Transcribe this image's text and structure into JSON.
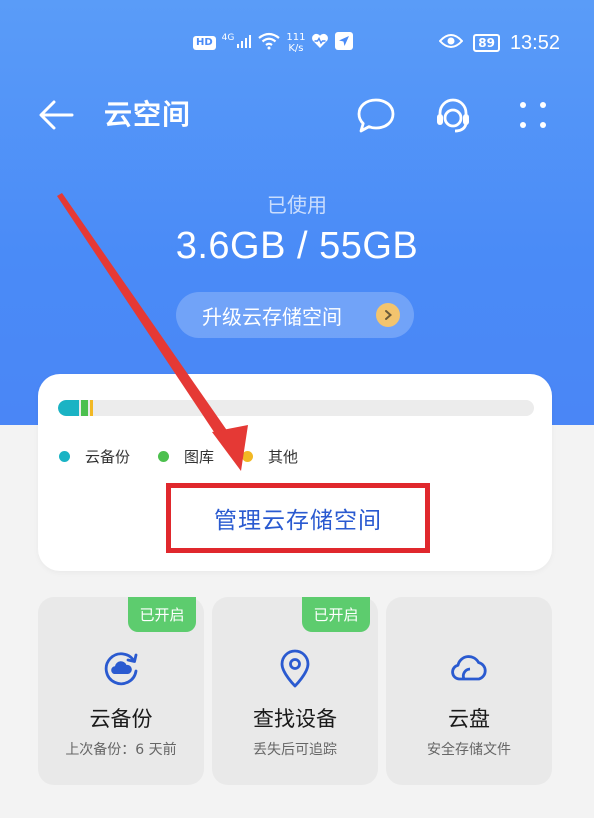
{
  "status_bar": {
    "hd": "HD",
    "network": "4G",
    "speed_value": "111",
    "speed_unit": "K/s",
    "battery": "89",
    "time": "13:52",
    "icons": [
      "signal-icon",
      "wifi-icon",
      "heart-icon",
      "location-arrow-icon",
      "eye-icon",
      "battery-icon"
    ]
  },
  "header": {
    "title": "云空间",
    "icons": [
      "back-arrow-icon",
      "chat-bubble-icon",
      "customer-service-icon",
      "more-dots-icon"
    ]
  },
  "usage": {
    "label": "已使用",
    "value": "3.6GB / 55GB",
    "upgrade_label": "升级云存储空间"
  },
  "storage_card": {
    "bar_segments": [
      {
        "name": "云备份",
        "fraction": 0.045,
        "color": "#1ab3c4"
      },
      {
        "name": "图库",
        "fraction": 0.014,
        "color": "#4cc04e"
      },
      {
        "name": "其他",
        "fraction": 0.006,
        "color": "#f2b824"
      }
    ],
    "legend": [
      {
        "label": "云备份",
        "color": "#1ab3c4"
      },
      {
        "label": "图库",
        "color": "#4cc04e"
      },
      {
        "label": "其他",
        "color": "#f2b824"
      }
    ],
    "manage_label": "管理云存储空间"
  },
  "tiles": [
    {
      "name": "云备份",
      "sub": "上次备份：6 天前",
      "badge": "已开启",
      "icon": "cloud-backup-icon"
    },
    {
      "name": "查找设备",
      "sub": "丢失后可追踪",
      "badge": "已开启",
      "icon": "location-pin-icon"
    },
    {
      "name": "云盘",
      "sub": "安全存储文件",
      "badge": "",
      "icon": "cloud-icon"
    }
  ],
  "colors": {
    "brand_blue": "#4a8bf7",
    "link_blue": "#2a5ad0",
    "badge_green": "#5dcc6e",
    "annotation_red": "#e0282d"
  }
}
